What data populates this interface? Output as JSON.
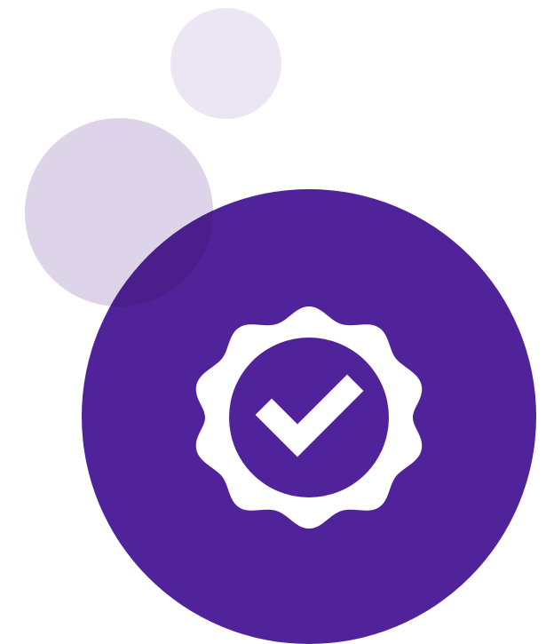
{
  "colors": {
    "background": "#ffffff",
    "main_circle": "#51239a",
    "bubble_small": "#ece6f4",
    "bubble_medium": "#ddd4ea",
    "overlap": "#4a1f8c",
    "icon": "#ffffff"
  },
  "icons": {
    "badge": "verified-badge-icon",
    "check": "check-icon"
  }
}
